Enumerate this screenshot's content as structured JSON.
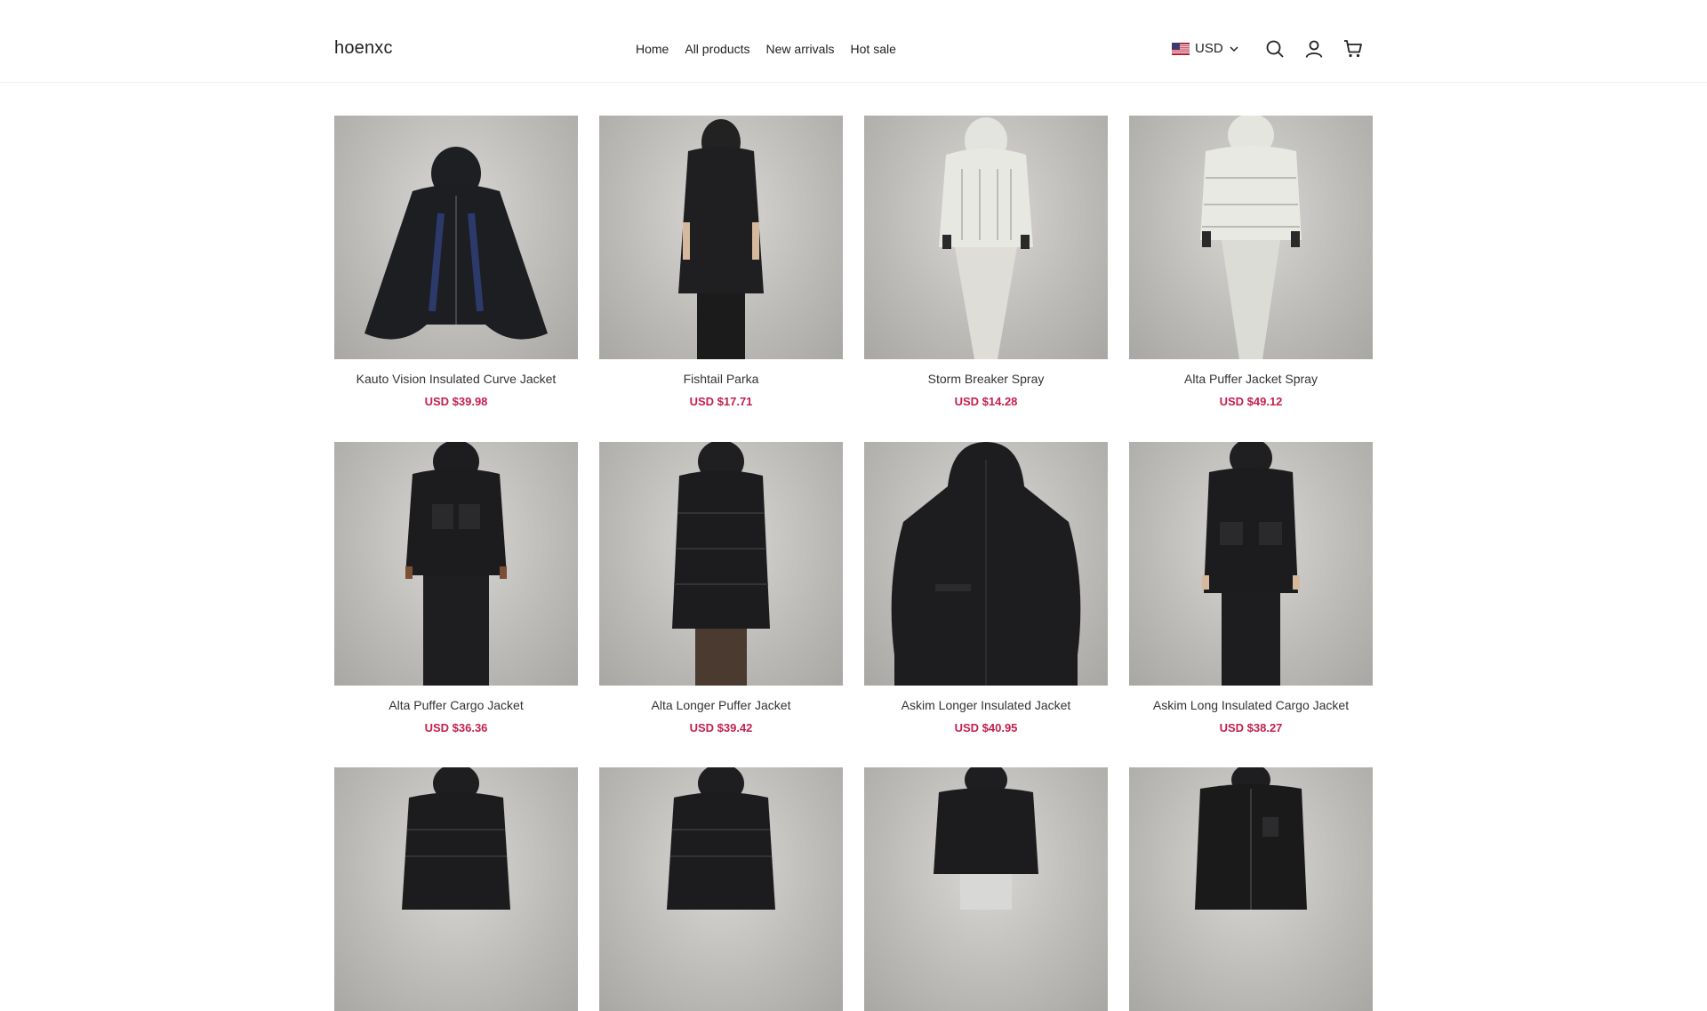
{
  "header": {
    "brand": "hoenxc",
    "nav": [
      "Home",
      "All products",
      "New arrivals",
      "Hot sale"
    ],
    "currency": "USD",
    "icons": [
      "us-flag-icon",
      "chevron-down-icon",
      "search-icon",
      "user-icon",
      "cart-icon"
    ]
  },
  "products": [
    {
      "title": "Kauto Vision Insulated Curve Jacket",
      "price": "USD $39.98"
    },
    {
      "title": "Fishtail Parka",
      "price": "USD $17.71"
    },
    {
      "title": "Storm Breaker Spray",
      "price": "USD $14.28"
    },
    {
      "title": "Alta Puffer Jacket Spray",
      "price": "USD $49.12"
    },
    {
      "title": "Alta Puffer Cargo Jacket",
      "price": "USD $36.36"
    },
    {
      "title": "Alta Longer Puffer Jacket",
      "price": "USD $39.42"
    },
    {
      "title": "Askim Longer Insulated Jacket",
      "price": "USD $40.95"
    },
    {
      "title": "Askim Long Insulated Cargo Jacket",
      "price": "USD $38.27"
    },
    {
      "title": "",
      "price": ""
    },
    {
      "title": "",
      "price": ""
    },
    {
      "title": "",
      "price": ""
    },
    {
      "title": "",
      "price": ""
    }
  ],
  "colors": {
    "price": "#c5204f",
    "border": "#ececec"
  }
}
